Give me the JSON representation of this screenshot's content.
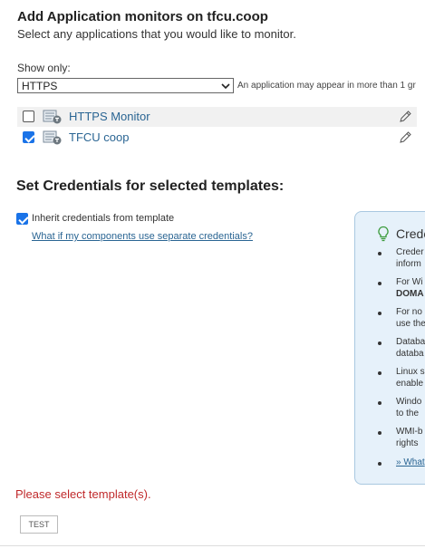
{
  "header": {
    "title": "Add Application monitors on tfcu.coop",
    "subtitle": "Select any applications that you would like to monitor."
  },
  "filter": {
    "label": "Show only:",
    "selected": "HTTPS",
    "hint": "An application may appear in more than 1 gr"
  },
  "applications": [
    {
      "name": "HTTPS Monitor",
      "checked": false
    },
    {
      "name": "TFCU coop",
      "checked": true
    }
  ],
  "credentials": {
    "section_title": "Set Credentials for selected templates:",
    "inherit_label": "Inherit credentials from template",
    "inherit_checked": true,
    "separate_link": "What if my components use separate credentials?"
  },
  "help_panel": {
    "title": "Crede",
    "items": [
      [
        "Creder",
        "inform"
      ],
      [
        "For Wi",
        "DOMA"
      ],
      [
        "For no",
        "use the"
      ],
      [
        "Databa",
        "databa"
      ],
      [
        "Linux s",
        "enable"
      ],
      [
        "Windo",
        "to the"
      ],
      [
        "WMI-b",
        "rights"
      ],
      [
        "» What"
      ]
    ]
  },
  "validation": {
    "error": "Please select template(s)."
  },
  "actions": {
    "test_label": "TEST"
  },
  "colors": {
    "accent": "#1a73e8",
    "link": "#2a6593",
    "error": "#c0292b",
    "panel_bg": "#e6f1fa"
  }
}
